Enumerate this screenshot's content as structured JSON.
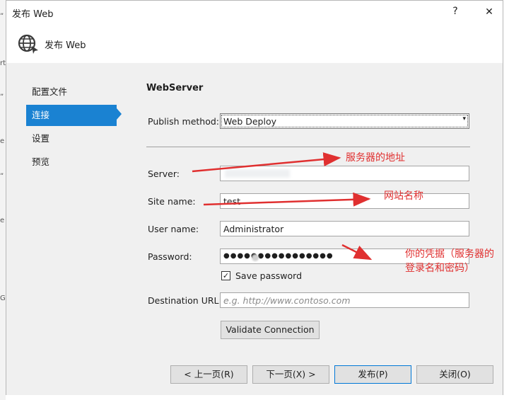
{
  "window": {
    "title": "发布 Web",
    "help_glyph": "?",
    "close_glyph": "✕"
  },
  "header": {
    "title": "发布 Web",
    "icon": "globe-icon"
  },
  "left_edge_fragments": [
    "„",
    "rt",
    "„",
    "e",
    "„",
    "e",
    "G"
  ],
  "nav": {
    "items": [
      {
        "label": "配置文件",
        "active": false
      },
      {
        "label": "连接",
        "active": true
      },
      {
        "label": "设置",
        "active": false
      },
      {
        "label": "预览",
        "active": false
      }
    ]
  },
  "form": {
    "section_title": "WebServer",
    "publish_method_label": "Publish method:",
    "publish_method_value": "Web Deploy",
    "server_label": "Server:",
    "server_value": "",
    "site_name_label": "Site name:",
    "site_name_value": "test",
    "user_name_label": "User name:",
    "user_name_value": "Administrator",
    "password_label": "Password:",
    "password_value": "●●●●●●●●●●●●●●●●",
    "save_password_label": "Save password",
    "save_password_checked": true,
    "destination_url_label": "Destination URL:",
    "destination_url_placeholder": "e.g. http://www.contoso.com",
    "validate_button": "Validate Connection"
  },
  "footer": {
    "prev_button": "< 上一页(R)",
    "next_button": "下一页(X) >",
    "publish_button": "发布(P)",
    "close_button": "关闭(O)"
  },
  "annotations": {
    "server": "服务器的地址",
    "site": "网站名称",
    "credentials_line1": "你的凭据（服务器的",
    "credentials_line2": "登录名和密码）",
    "color": "#e03030"
  },
  "colors": {
    "accent": "#1a82d2",
    "panel": "#f0f0f0"
  }
}
